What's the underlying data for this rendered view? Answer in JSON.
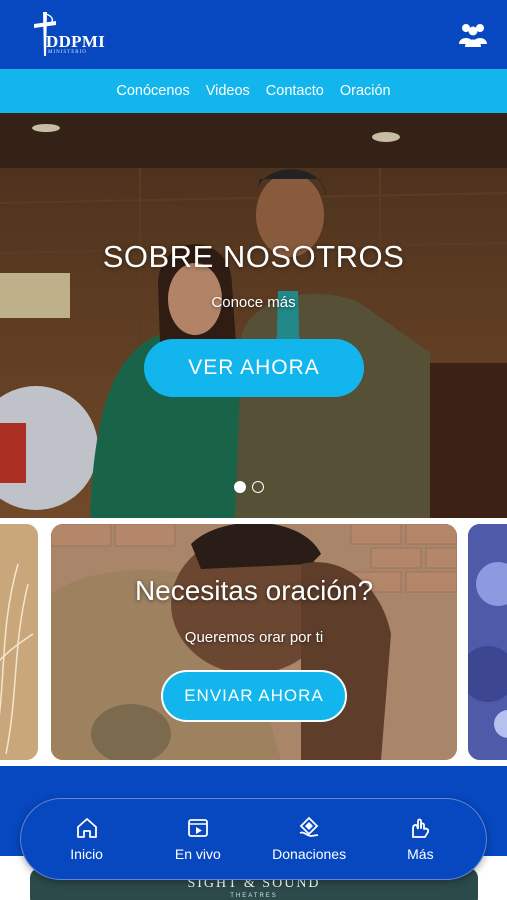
{
  "header": {
    "logo_text": "DDPMI",
    "logo_sub": "MINISTERIO",
    "people_icon": "people-group-icon"
  },
  "nav": {
    "items": [
      "Conócenos",
      "Videos",
      "Contacto",
      "Oración"
    ]
  },
  "hero": {
    "title": "SOBRE NOSOTROS",
    "subtitle": "Conoce más",
    "button": "VER AHORA",
    "slide_count": 2,
    "active_slide": 1
  },
  "prayer_card": {
    "title": "Necesitas oración?",
    "subtitle": "Queremos orar por ti",
    "button": "ENVIAR AHORA"
  },
  "promo": {
    "text": "SIGHT & SOUND",
    "sub": "THEATRES"
  },
  "tabs": [
    {
      "label": "Inicio",
      "icon": "home-icon"
    },
    {
      "label": "En vivo",
      "icon": "play-video-icon"
    },
    {
      "label": "Donaciones",
      "icon": "donation-hand-icon"
    },
    {
      "label": "Más",
      "icon": "more-hands-icon"
    }
  ],
  "colors": {
    "primary_blue": "#0748c0",
    "accent_cyan": "#12b6ec"
  }
}
